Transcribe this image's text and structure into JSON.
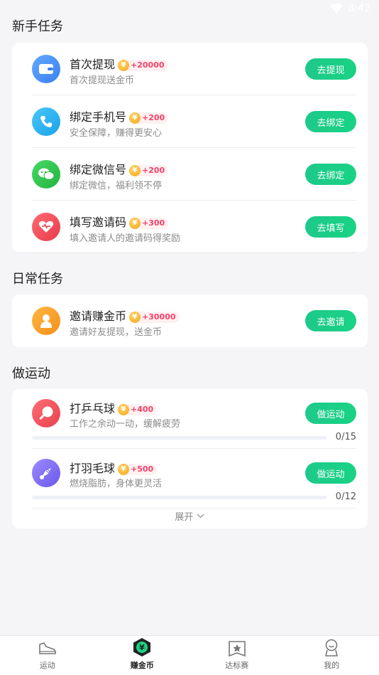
{
  "status": {
    "time": "8:42"
  },
  "sections": {
    "newbie_title": "新手任务",
    "daily_title": "日常任务",
    "sport_title": "做运动"
  },
  "newbie_tasks": [
    {
      "name": "首次提现",
      "reward": "+20000",
      "desc": "首次提现送金币",
      "button": "去提现",
      "icon": "wallet-icon",
      "color": "#4a90f5"
    },
    {
      "name": "绑定手机号",
      "reward": "+200",
      "desc": "安全保障，赚得更安心",
      "button": "去绑定",
      "icon": "phone-icon",
      "color": "#27b3f0"
    },
    {
      "name": "绑定微信号",
      "reward": "+200",
      "desc": "绑定微信，福利领不停",
      "button": "去绑定",
      "icon": "wechat-icon",
      "color": "#2bc44b"
    },
    {
      "name": "填写邀请码",
      "reward": "+300",
      "desc": "填入邀请人的邀请码得奖励",
      "button": "去填写",
      "icon": "heart-icon",
      "color": "#f04b58"
    }
  ],
  "daily_tasks": [
    {
      "name": "邀请赚金币",
      "reward": "+30000",
      "desc": "邀请好友提现，送金币",
      "button": "去邀请",
      "icon": "user-icon",
      "color": "#f7a12a"
    }
  ],
  "sport_tasks": [
    {
      "name": "打乒乓球",
      "reward": "+400",
      "desc": "工作之余动一动，缓解疲劳",
      "button": "做运动",
      "icon": "paddle-icon",
      "color": "#f0505a",
      "progress_text": "0/15",
      "progress": 0
    },
    {
      "name": "打羽毛球",
      "reward": "+500",
      "desc": "燃烧脂肪，身体更灵活",
      "button": "做运动",
      "icon": "shuttlecock-icon",
      "color": "#7b6cf0",
      "progress_text": "0/12",
      "progress": 0
    }
  ],
  "expand_label": "展开",
  "coin_symbol": "¥",
  "tabs": [
    {
      "label": "运动",
      "icon": "shoe-icon"
    },
    {
      "label": "赚金币",
      "icon": "coin-badge-icon"
    },
    {
      "label": "达标赛",
      "icon": "star-frame-icon"
    },
    {
      "label": "我的",
      "icon": "profile-icon"
    }
  ]
}
